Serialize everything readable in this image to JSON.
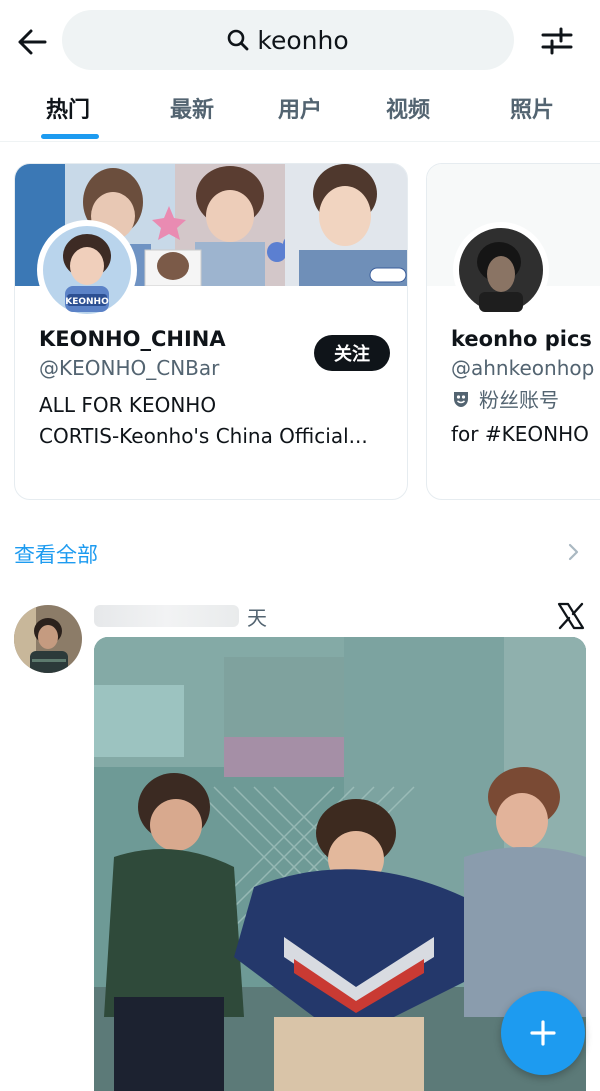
{
  "search": {
    "query": "keonho"
  },
  "tabs": [
    {
      "label": "热门",
      "active": true
    },
    {
      "label": "最新",
      "active": false
    },
    {
      "label": "用户",
      "active": false
    },
    {
      "label": "视频",
      "active": false
    },
    {
      "label": "照片",
      "active": false
    }
  ],
  "users": [
    {
      "name": "KEONHO_CHINA",
      "handle": "@KEONHO_CNBar",
      "follow_label": "关注",
      "bio_lines": [
        "ALL FOR KEONHO",
        "CORTIS-Keonho's China Official..."
      ],
      "avatar_caption": "KEONHO"
    },
    {
      "name": "keonho pics",
      "handle": "@ahnkeonhop",
      "badge_label": "粉丝账号",
      "bio_lines": [
        "for #KEONHO"
      ]
    }
  ],
  "see_all": "查看全部",
  "post": {
    "time_suffix": "天"
  },
  "icons": {
    "back": "arrow-left-icon",
    "search": "search-icon",
    "filter": "sliders-icon",
    "chevron": "chevron-right-icon",
    "x_logo": "x-logo-icon",
    "compose": "plus-icon",
    "fan_badge": "theater-mask-icon"
  },
  "colors": {
    "accent": "#1d9bf0",
    "text": "#0f1419",
    "muted": "#536471"
  }
}
